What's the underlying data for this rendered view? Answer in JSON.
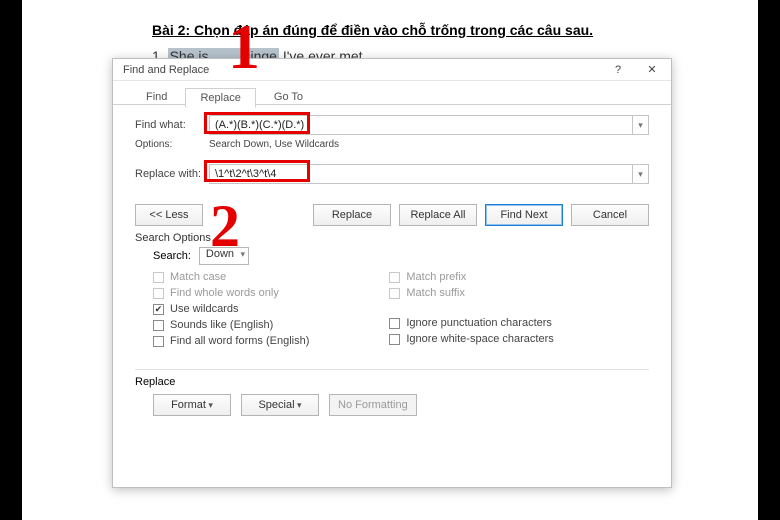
{
  "document": {
    "title": "Bài 2: Chọn đáp án đúng để điền vào chỗ trống trong các câu sau.",
    "line_number": "1.",
    "line_selected": "She is ....... singe",
    "line_rest": "I've ever met."
  },
  "dialog": {
    "title": "Find and Replace",
    "help_symbol": "?",
    "close_symbol": "✕",
    "tabs": {
      "find": "Find",
      "replace": "Replace",
      "goto": "Go To"
    },
    "find_label": "Find what:",
    "find_value": "(A.*)(B.*)(C.*)(D.*)",
    "options_label": "Options:",
    "options_value": "Search Down, Use Wildcards",
    "replace_label": "Replace with:",
    "replace_value": "\\1^t\\2^t\\3^t\\4",
    "buttons": {
      "less": "<< Less",
      "replace": "Replace",
      "replace_all": "Replace All",
      "find_next": "Find Next",
      "cancel": "Cancel",
      "format": "Format",
      "special": "Special",
      "no_formatting": "No Formatting"
    },
    "search_options_title": "Search Options",
    "search_dir_label": "Search:",
    "search_dir_value": "Down",
    "checkboxes": {
      "match_case": "Match case",
      "whole_words": "Find whole words only",
      "use_wildcards": "Use wildcards",
      "sounds_like": "Sounds like (English)",
      "all_word_forms": "Find all word forms (English)",
      "match_prefix": "Match prefix",
      "match_suffix": "Match suffix",
      "ignore_punct": "Ignore punctuation characters",
      "ignore_ws": "Ignore white-space characters"
    },
    "replace_section": "Replace"
  },
  "annotations": {
    "one": "1",
    "two": "2"
  }
}
